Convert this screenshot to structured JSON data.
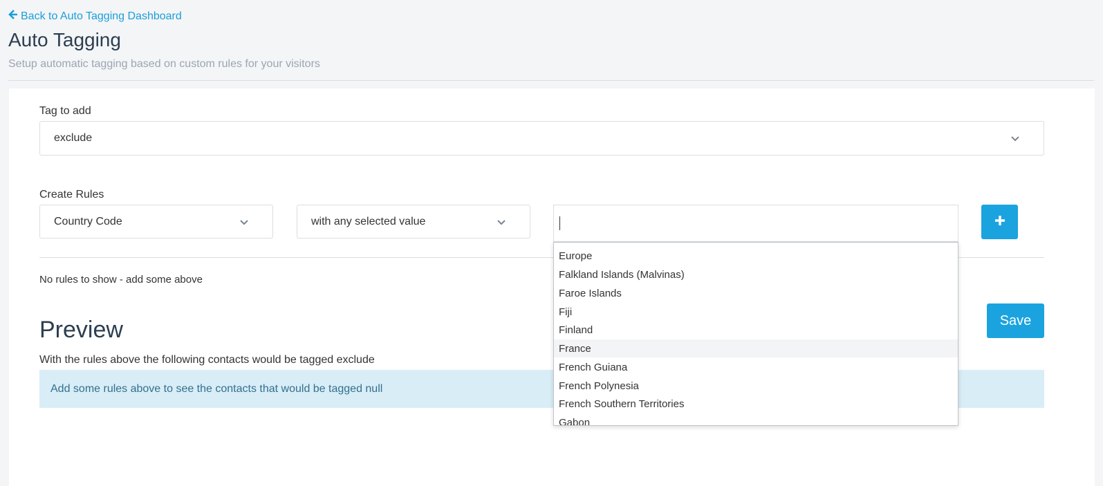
{
  "header": {
    "back_link": "Back to Auto Tagging Dashboard",
    "title": "Auto Tagging",
    "subtitle": "Setup automatic tagging based on custom rules for your visitors"
  },
  "tag_section": {
    "label": "Tag to add",
    "selected": "exclude"
  },
  "rules_section": {
    "label": "Create Rules",
    "field_select": "Country Code",
    "operator_select": "with any selected value",
    "value_input": "",
    "add_button_icon": "plus-icon",
    "empty_message": "No rules to show - add some above"
  },
  "dropdown": {
    "options": [
      {
        "label": "Europe",
        "highlighted": false
      },
      {
        "label": "Falkland Islands (Malvinas)",
        "highlighted": false
      },
      {
        "label": "Faroe Islands",
        "highlighted": false
      },
      {
        "label": "Fiji",
        "highlighted": false
      },
      {
        "label": "Finland",
        "highlighted": false
      },
      {
        "label": "France",
        "highlighted": true
      },
      {
        "label": "French Guiana",
        "highlighted": false
      },
      {
        "label": "French Polynesia",
        "highlighted": false
      },
      {
        "label": "French Southern Territories",
        "highlighted": false
      },
      {
        "label": "Gabon",
        "highlighted": false
      }
    ]
  },
  "save_button": "Save",
  "preview": {
    "heading": "Preview",
    "description": "With the rules above the following contacts would be tagged exclude",
    "info": "Add some rules above to see the contacts that would be tagged null"
  },
  "colors": {
    "accent": "#1aa3df",
    "info_bg": "#d9edf7",
    "info_text": "#31708f"
  }
}
